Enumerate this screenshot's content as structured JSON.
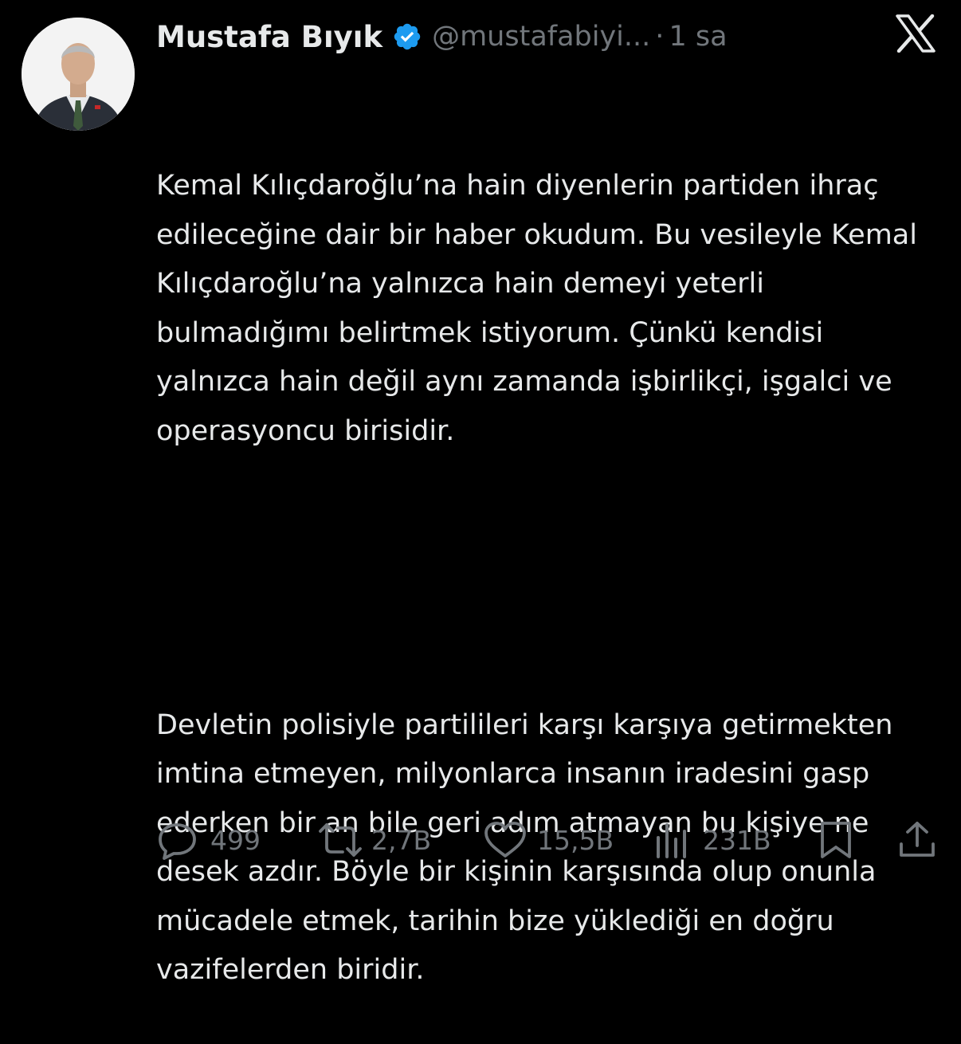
{
  "tweet": {
    "author_name": "Mustafa Bıyık",
    "handle": "@mustafabiyi...",
    "separator": "·",
    "timestamp": "1 sa",
    "paragraphs": [
      "Kemal Kılıçdaroğlu’na hain diyenlerin partiden ihraç edileceğine dair bir haber okudum. Bu vesileyle Kemal Kılıçdaroğlu’na yalnızca hain demeyi yeterli bulmadığımı belirtmek istiyorum. Çünkü kendisi yalnızca hain değil aynı zamanda işbirlikçi, işgalci ve operasyoncu birisidir.",
      "Devletin polisiyle partilileri karşı karşıya getirmekten imtina etmeyen, milyonlarca insanın iradesini gasp ederken bir an bile geri adım atmayan bu kişiye ne desek azdır. Böyle bir kişinin karşısında olup onunla mücadele etmek, tarihin bize yüklediği en doğru vazifelerden biridir."
    ]
  },
  "actions": {
    "replies": "499",
    "reposts": "2,7B",
    "likes": "15,5B",
    "views": "231B"
  },
  "icons": {
    "verified": "verified-badge-icon",
    "logo": "x-logo-icon",
    "reply": "reply-icon",
    "repost": "repost-icon",
    "like": "like-icon",
    "views": "views-icon",
    "bookmark": "bookmark-icon",
    "share": "share-icon"
  },
  "colors": {
    "background": "#000000",
    "text": "#e7e9ea",
    "muted": "#71767b",
    "verified": "#1d9bf0"
  }
}
